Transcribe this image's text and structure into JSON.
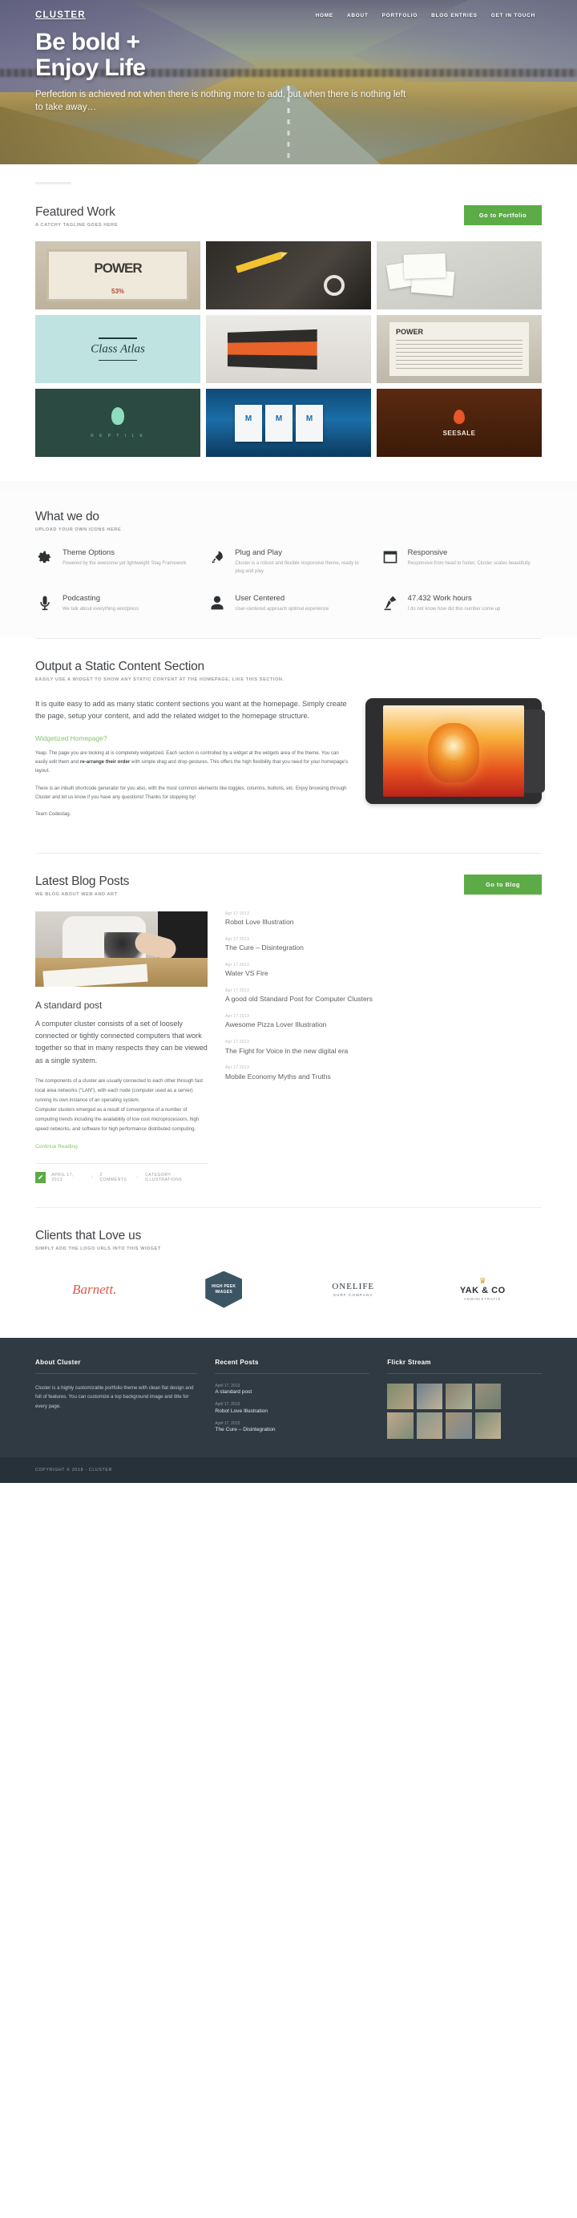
{
  "brand": "CLUSTER",
  "nav": [
    {
      "label": "HOME"
    },
    {
      "label": "ABOUT"
    },
    {
      "label": "PORTFOLIO"
    },
    {
      "label": "BLOG ENTRIES"
    },
    {
      "label": "GET IN TOUCH"
    }
  ],
  "hero": {
    "title_line1": "Be bold +",
    "title_line2": "Enjoy Life",
    "subtitle": "Perfection is achieved not when there is nothing more to add, but when there is nothing left to take away…"
  },
  "featured": {
    "title": "Featured Work",
    "tagline": "A CATCHY TAGLINE GOES HERE",
    "button": "Go to Portfolio",
    "tiles": [
      {
        "name": "power-poster",
        "word": "POWER",
        "accent": "53%"
      },
      {
        "name": "pencil-clip"
      },
      {
        "name": "business-cards"
      },
      {
        "name": "class-atlas-logo",
        "script": "Class Atlas"
      },
      {
        "name": "orange-book"
      },
      {
        "name": "newspaper-powz",
        "word": "POWER"
      },
      {
        "name": "green-mark",
        "sub": "R E P T I L E"
      },
      {
        "name": "blue-brochures",
        "letter": "M"
      },
      {
        "name": "seesale-logo",
        "label": "SEESALE"
      }
    ]
  },
  "services": {
    "title": "What we do",
    "tagline": "UPLOAD YOUR OWN ICONS HERE",
    "items": [
      {
        "icon": "gear-icon",
        "title": "Theme Options",
        "desc": "Powered by the awesome yet lightweight Stag Framework"
      },
      {
        "icon": "rocket-icon",
        "title": "Plug and Play",
        "desc": "Cluster is a robust and flexible responsive theme, ready to plug and play"
      },
      {
        "icon": "browser-window-icon",
        "title": "Responsive",
        "desc": "Responsive from head to footer, Cluster scales beautifully"
      },
      {
        "icon": "microphone-icon",
        "title": "Podcasting",
        "desc": "We talk about everything wordpress"
      },
      {
        "icon": "user-icon",
        "title": "User Centered",
        "desc": "User-centered approach optimal experience"
      },
      {
        "icon": "desk-lamp-icon",
        "title": "47.432 Work hours",
        "desc": "I do not know how did this number come up"
      }
    ]
  },
  "static_section": {
    "title": "Output a Static Content Section",
    "tagline": "EASILY USE A WIDGET TO SHOW ANY STATIC CONTENT AT THE HOMEPAGE, LIKE THIS SECTION.",
    "lead": "It is quite easy to add as many static content sections you want at the homepage. Simply create the page, setup your content, and add the related widget to the homepage structure.",
    "subheading": "Widgetized Homepage?",
    "para1_a": "Yeap. The page you are looking at is completely widgetized. Each section is controlled by a widget at the widgets area of the theme. You can easily edit them and ",
    "para1_b": "re-arrange their order",
    "para1_c": " with simple drag and drop gestures. This offers the high flexibility that you need for your homepage's layout.",
    "para2": "There is an inbuilt shortcode generator for you also, with the most common elements like toggles, columns, buttons, etc. Enjoy browsing through Cluster and let us know if you have any questions! Thanks for stopping by!",
    "signoff": "Team Codestag."
  },
  "blog": {
    "title": "Latest Blog Posts",
    "tagline": "WE BLOG ABOUT WEB AND ART",
    "button": "Go to Blog",
    "post": {
      "title": "A standard post",
      "lead": "A computer cluster consists of a set of loosely connected or tightly connected computers that work together so that in many respects they can be viewed as a single system.",
      "body1": "The components of a cluster are usually connected to each other through fast local area networks (\"LAN\"), with each node (computer used as a server) running its own instance of an operating system.",
      "body2": "Computer clusters emerged as a result of convergence of a number of computing trends including the availability of low cost microprocessors, high speed networks, and software for high performance distributed computing.",
      "read_more": "Continue Reading",
      "meta_date": "APRIL 17, 2013",
      "meta_comments": "2 COMMENTS",
      "meta_category": "CATEGORY: ILLUSTRATIONS",
      "meta_separator": "/"
    },
    "recent": [
      {
        "date": "Apr 17 2013",
        "title": "Robot Love Illustration"
      },
      {
        "date": "Apr 17 2013",
        "title": "The Cure – Disintegration"
      },
      {
        "date": "Apr 17 2013",
        "title": "Water VS Fire"
      },
      {
        "date": "Apr 17 2013",
        "title": "A good old Standard Post for Computer Clusters"
      },
      {
        "date": "Apr 17 2013",
        "title": "Awesome Pizza Lover Illustration"
      },
      {
        "date": "Apr 17 2013",
        "title": "The Fight for Voice in the new digital era"
      },
      {
        "date": "Apr 17 2013",
        "title": "Mobile Economy Myths and Truths"
      }
    ]
  },
  "clients": {
    "title": "Clients that Love us",
    "tagline": "SIMPLY ADD THE LOGO URLS INTO THIS WIDGET",
    "logos": [
      {
        "name": "barnett-logo",
        "text": "Barnett."
      },
      {
        "name": "high-peek-images-logo",
        "text": "HIGH PEEK IMAGES"
      },
      {
        "name": "onelife-surf-company-logo",
        "text": "ONELIFE",
        "sub": "SURF COMPANY"
      },
      {
        "name": "yak-and-co-logo",
        "text": "YAK & CO",
        "sub": "ADMINISTRATIE"
      }
    ]
  },
  "footer": {
    "about": {
      "title": "About Cluster",
      "text": "Cluster is a highly customizable portfolio theme with clean flat design and full of features. You can customize a top background image and title for every page."
    },
    "recent": {
      "title": "Recent Posts",
      "items": [
        {
          "date": "April 17, 2013",
          "title": "A standard post"
        },
        {
          "date": "April 17, 2013",
          "title": "Robot Love Illustration"
        },
        {
          "date": "April 17, 2013",
          "title": "The Cure – Disintegration"
        }
      ]
    },
    "flickr": {
      "title": "Flickr Stream",
      "count": 8
    },
    "copyright": "COPYRIGHT © 2018 - CLUSTER"
  },
  "colors": {
    "accent_green": "#5cab46",
    "light_green": "#86c46e",
    "footer_bg": "#2f3a42",
    "copyright_bg": "#27313a"
  }
}
